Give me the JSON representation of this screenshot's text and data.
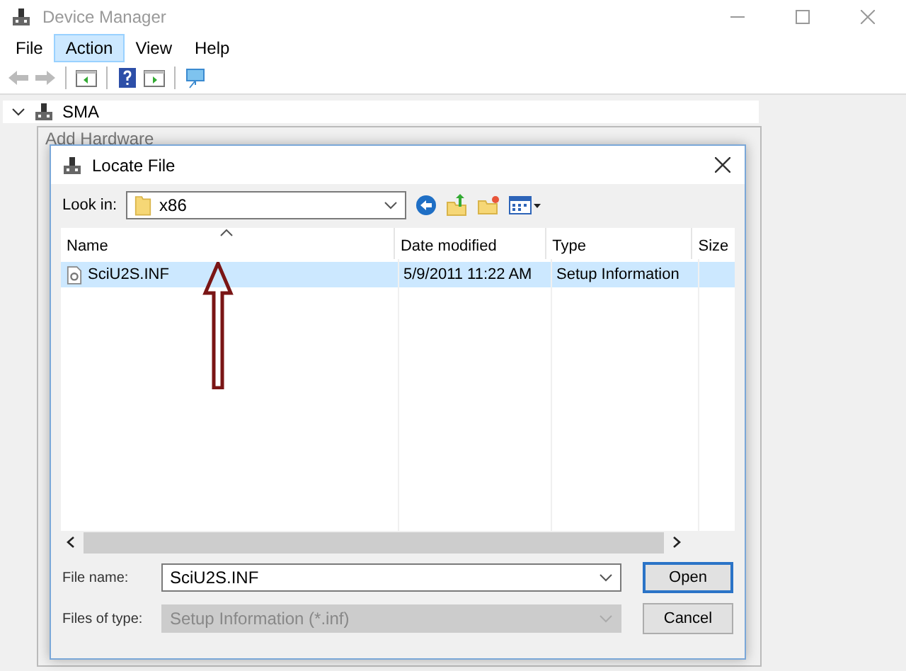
{
  "window": {
    "title": "Device Manager"
  },
  "menu": [
    {
      "label": "File",
      "selected": false
    },
    {
      "label": "Action",
      "selected": true
    },
    {
      "label": "View",
      "selected": false
    },
    {
      "label": "Help",
      "selected": false
    }
  ],
  "tree": {
    "label": "SMA",
    "expanded": true
  },
  "background_window": {
    "title": "Add Hardware"
  },
  "dialog": {
    "title": "Locate File",
    "look_in_label": "Look in:",
    "look_in_value": "x86",
    "columns": [
      {
        "label": "Name",
        "sorted": true
      },
      {
        "label": "Date modified",
        "sorted": false
      },
      {
        "label": "Type",
        "sorted": false
      },
      {
        "label": "Size",
        "sorted": false
      }
    ],
    "rows": [
      {
        "name": "SciU2S.INF",
        "date": "5/9/2011 11:22 AM",
        "type": "Setup Information",
        "selected": true
      }
    ],
    "file_name_label": "File name:",
    "file_name": "SciU2S.INF",
    "file_type_label": "Files of type:",
    "file_type": "Setup Information (*.inf)",
    "file_type_disabled": true,
    "buttons": [
      {
        "label": "Open",
        "default": true
      },
      {
        "label": "Cancel",
        "default": false
      }
    ]
  }
}
